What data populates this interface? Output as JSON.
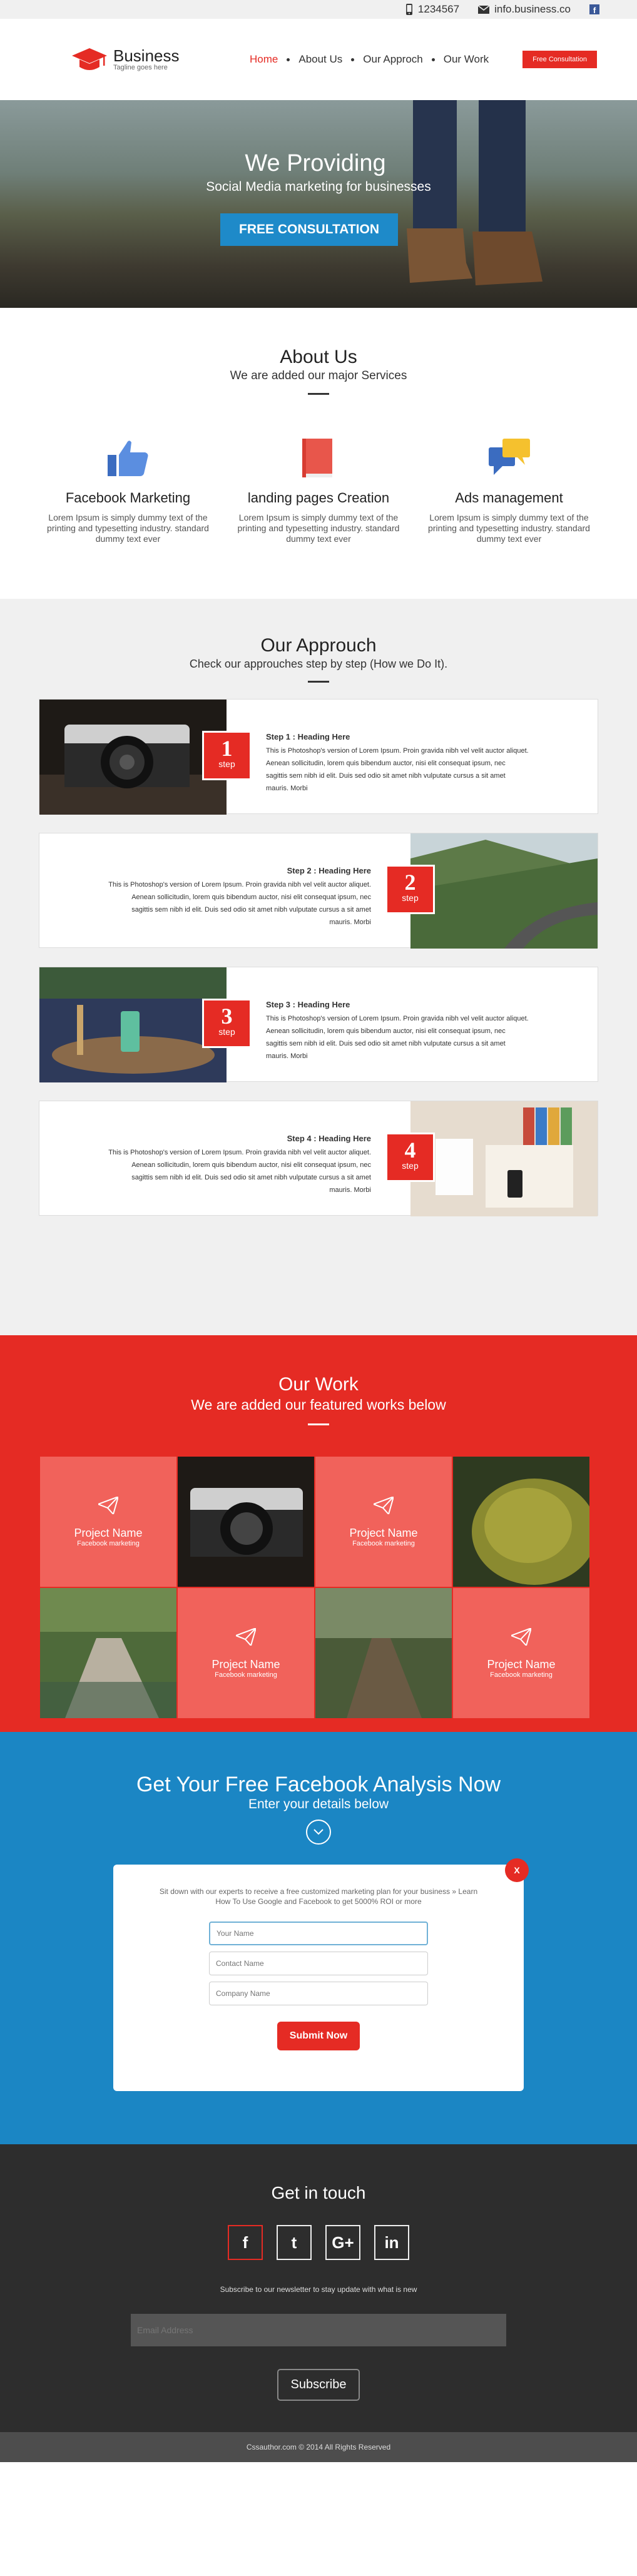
{
  "topbar": {
    "phone": "1234567",
    "email": "info.business.co",
    "fb_letter": "f"
  },
  "brand": {
    "name": "Business",
    "tagline": "Tagline goes here"
  },
  "nav": {
    "items": [
      "Home",
      "About Us",
      "Our Approch",
      "Our Work"
    ],
    "active": "Home",
    "cta": "Free Consultation"
  },
  "hero": {
    "title": "We Providing",
    "subtitle": "Social Media marketing for businesses",
    "button": "FREE CONSULTATION"
  },
  "about": {
    "title": "About Us",
    "subtitle": "We are added our major Services",
    "services": [
      {
        "icon": "thumbs-up-icon",
        "title": "Facebook Marketing",
        "text": "Lorem Ipsum is simply dummy text of the printing and typesetting industry. standard dummy text ever"
      },
      {
        "icon": "book-icon",
        "title": "landing pages Creation",
        "text": "Lorem Ipsum is simply dummy text of the printing and typesetting industry. standard dummy text ever"
      },
      {
        "icon": "chat-bubbles-icon",
        "title": "Ads management",
        "text": "Lorem Ipsum is simply dummy text of the printing and typesetting industry. standard dummy text ever"
      }
    ]
  },
  "approach": {
    "title": "Our Approuch",
    "subtitle": "Check our approuches step by step (How we Do It).",
    "step_word": "step",
    "steps": [
      {
        "num": "1",
        "heading": "Step 1 : Heading Here",
        "text": "This is Photoshop's version of Lorem Ipsum. Proin gravida nibh vel velit auctor aliquet. Aenean sollicitudin, lorem quis bibendum auctor, nisi elit consequat ipsum, nec sagittis sem nibh id elit. Duis sed odio sit amet nibh vulputate cursus a sit amet mauris. Morbi"
      },
      {
        "num": "2",
        "heading": "Step 2 : Heading Here",
        "text": "This is Photoshop's version of Lorem Ipsum. Proin gravida nibh vel velit auctor aliquet. Aenean sollicitudin, lorem quis bibendum auctor, nisi elit consequat ipsum, nec sagittis sem nibh id elit. Duis sed odio sit amet nibh vulputate cursus a sit amet mauris. Morbi"
      },
      {
        "num": "3",
        "heading": "Step 3 : Heading Here",
        "text": "This is Photoshop's version of Lorem Ipsum. Proin gravida nibh vel velit auctor aliquet. Aenean sollicitudin, lorem quis bibendum auctor, nisi elit consequat ipsum, nec sagittis sem nibh id elit. Duis sed odio sit amet nibh vulputate cursus a sit amet mauris. Morbi"
      },
      {
        "num": "4",
        "heading": "Step 4 : Heading Here",
        "text": "This is Photoshop's version of Lorem Ipsum. Proin gravida nibh vel velit auctor aliquet. Aenean sollicitudin, lorem quis bibendum auctor, nisi elit consequat ipsum, nec sagittis sem nibh id elit. Duis sed odio sit amet nibh vulputate cursus a sit amet mauris. Morbi"
      }
    ]
  },
  "work": {
    "title": "Our Work",
    "subtitle": "We are added  our featured works below",
    "project_name": "Project Name",
    "project_cat": "Facebook marketing"
  },
  "analysis": {
    "title": "Get Your Free Facebook Analysis Now",
    "subtitle": "Enter your details below",
    "close": "X",
    "desc": "Sit down with our experts to receive a free customized marketing plan for your business » Learn How To Use Google and Facebook to get 5000% ROI or more",
    "fields": [
      "Your Name",
      "Contact Name",
      "Company Name"
    ],
    "submit": "Submit Now"
  },
  "contact": {
    "title": "Get in touch",
    "socials": [
      "f",
      "t",
      "G+",
      "in"
    ],
    "newsletter": "Subscribe to our newsletter to stay update with what is new",
    "email_placeholder": "Email Address",
    "subscribe": "Subscribe"
  },
  "footer": {
    "text": "Cssauthor.com © 2014 All Rights Reserved"
  },
  "colors": {
    "accent": "#e52b24",
    "blue": "#1b86c4",
    "dark": "#2d2d2d",
    "light": "#f0f0f0",
    "facebook": "#3b5998"
  }
}
